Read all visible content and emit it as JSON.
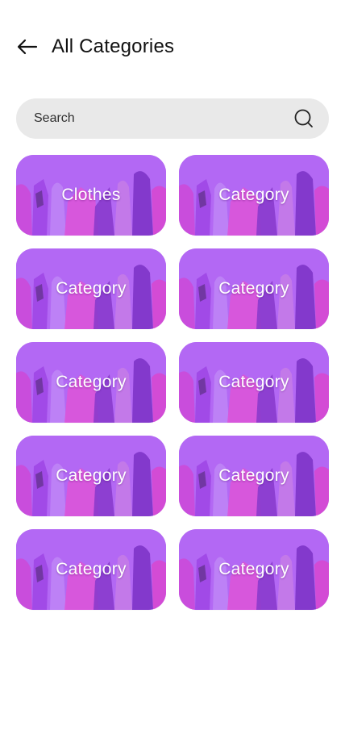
{
  "header": {
    "title": "All Categories",
    "back_icon": "arrow-left-icon"
  },
  "search": {
    "placeholder": "Search",
    "value": "",
    "icon": "search-icon"
  },
  "categories": [
    {
      "label": "Clothes"
    },
    {
      "label": "Category"
    },
    {
      "label": "Category"
    },
    {
      "label": "Category"
    },
    {
      "label": "Category"
    },
    {
      "label": "Category"
    },
    {
      "label": "Category"
    },
    {
      "label": "Category"
    },
    {
      "label": "Category"
    },
    {
      "label": "Category"
    }
  ],
  "colors": {
    "card_overlay": "#b266f2",
    "search_bg": "#e9e9e9",
    "text": "#111111"
  }
}
